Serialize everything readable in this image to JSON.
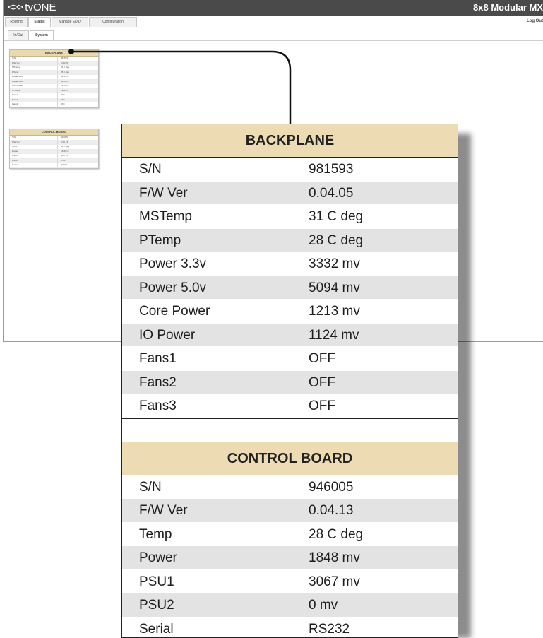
{
  "app": {
    "brand": "tvONE",
    "device_title": "8x8 Modular MX",
    "logout_label": "Log Out",
    "tabs": [
      "Routing",
      "Status",
      "Manage EDID",
      "Configuration"
    ],
    "subtabs": [
      "In/Out",
      "System"
    ]
  },
  "backplane": {
    "title": "BACKPLANE",
    "rows": [
      {
        "k": "S/N",
        "v": "981593"
      },
      {
        "k": "F/W Ver",
        "v": "0.04.05"
      },
      {
        "k": "MSTemp",
        "v": "31 C deg"
      },
      {
        "k": "PTemp",
        "v": "28 C deg"
      },
      {
        "k": "Power 3.3v",
        "v": "3332 mv"
      },
      {
        "k": "Power 5.0v",
        "v": "5094 mv"
      },
      {
        "k": "Core Power",
        "v": "1213 mv"
      },
      {
        "k": "IO Power",
        "v": "1124 mv"
      },
      {
        "k": "Fans1",
        "v": "OFF"
      },
      {
        "k": "Fans2",
        "v": "OFF"
      },
      {
        "k": "Fans3",
        "v": "OFF"
      }
    ]
  },
  "control_board": {
    "title": "CONTROL BOARD",
    "rows": [
      {
        "k": "S/N",
        "v": "946005"
      },
      {
        "k": "F/W Ver",
        "v": "0.04.13"
      },
      {
        "k": "Temp",
        "v": "28 C deg"
      },
      {
        "k": "Power",
        "v": "1848 mv"
      },
      {
        "k": "PSU1",
        "v": "3067 mv"
      },
      {
        "k": "PSU2",
        "v": "0 mv"
      },
      {
        "k": "Serial",
        "v": "RS232"
      }
    ]
  },
  "colors": {
    "header_bg": "#eddbb4",
    "alt_row": "#e3e3e3",
    "titlebar": "#4a4a4a"
  }
}
